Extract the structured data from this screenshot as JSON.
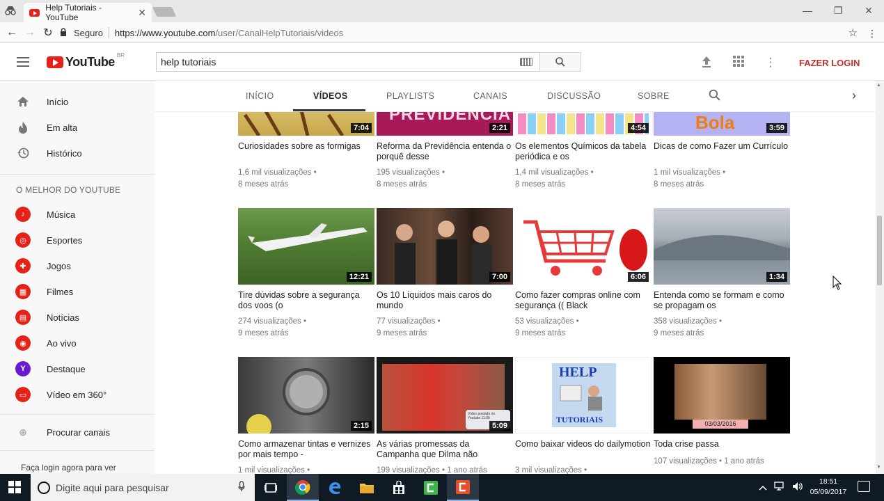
{
  "browser": {
    "tab_title": "Help Tutoriais - YouTube",
    "secure_label": "Seguro",
    "url_host": "https://www.youtube.com",
    "url_path": "/user/CanalHelpTutoriais/videos"
  },
  "header": {
    "logo_text": "YouTube",
    "logo_region": "BR",
    "search_value": "help tutoriais",
    "login_label": "FAZER LOGIN"
  },
  "sidebar": {
    "main": [
      {
        "label": "Início",
        "icon": "home-icon"
      },
      {
        "label": "Em alta",
        "icon": "flame-icon"
      },
      {
        "label": "Histórico",
        "icon": "history-icon"
      }
    ],
    "best_heading": "O MELHOR DO YOUTUBE",
    "best": [
      {
        "label": "Música",
        "icon": "music-icon"
      },
      {
        "label": "Esportes",
        "icon": "sports-icon"
      },
      {
        "label": "Jogos",
        "icon": "gamepad-icon"
      },
      {
        "label": "Filmes",
        "icon": "film-icon"
      },
      {
        "label": "Notícias",
        "icon": "news-icon"
      },
      {
        "label": "Ao vivo",
        "icon": "live-icon"
      },
      {
        "label": "Destaque",
        "icon": "spotlight-icon"
      },
      {
        "label": "Vídeo em 360°",
        "icon": "video360-icon"
      }
    ],
    "browse_channels": "Procurar canais",
    "login_prompt": "Faça login agora para ver"
  },
  "channel_tabs": {
    "items": [
      "INÍCIO",
      "VÍDEOS",
      "PLAYLISTS",
      "CANAIS",
      "DISCUSSÃO",
      "SOBRE"
    ],
    "active": "VÍDEOS"
  },
  "videos": [
    {
      "title": "Curiosidades sobre as formigas",
      "views": "1,6 mil visualizações",
      "age": "8 meses atrás",
      "duration": "7:04"
    },
    {
      "title": "Reforma da Previdência entenda o porquê desse",
      "views": "195 visualizações",
      "age": "8 meses atrás",
      "duration": "2:21",
      "thumb_text": "PREVIDÊNCIA"
    },
    {
      "title": "Os elementos Químicos da tabela periódica e os",
      "views": "1,4 mil visualizações",
      "age": "8 meses atrás",
      "duration": "4:54"
    },
    {
      "title": "Dicas de como Fazer um Currículo",
      "views": "1 mil visualizações",
      "age": "8 meses atrás",
      "duration": "3:59",
      "thumb_text": "Bola"
    },
    {
      "title": "Tire dúvidas sobre a segurança dos voos (o",
      "views": "274 visualizações",
      "age": "9 meses atrás",
      "duration": "12:21"
    },
    {
      "title": "Os 10 Líquidos mais caros do mundo",
      "views": "77 visualizações",
      "age": "9 meses atrás",
      "duration": "7:00"
    },
    {
      "title": "Como fazer compras online com segurança (( Black",
      "views": "53 visualizações",
      "age": "9 meses atrás",
      "duration": "6:06"
    },
    {
      "title": "Entenda como se formam e como se propagam os",
      "views": "358 visualizações",
      "age": "9 meses atrás",
      "duration": "1:34"
    },
    {
      "title": "Como armazenar tintas e vernizes por mais tempo -",
      "views": "1 mil visualizações",
      "age": "",
      "duration": "2:15"
    },
    {
      "title": "As várias promessas da Campanha que Dilma não",
      "views": "199 visualizações",
      "age": "1 ano atrás",
      "duration": "5:09",
      "thumb_text": "Vídeo postado no Youtube 11:09"
    },
    {
      "title": "Como baixar videos do dailymotion",
      "views": "3 mil visualizações",
      "age": "",
      "duration": "",
      "thumb_text_top": "HELP",
      "thumb_text_bottom": "TUTORIAIS"
    },
    {
      "title": "Toda crise passa",
      "views": "107 visualizações",
      "age": "1 ano atrás",
      "duration": "",
      "thumb_text": "03/03/2016"
    }
  ],
  "taskbar": {
    "search_placeholder": "Digite aqui para pesquisar",
    "time": "18:51",
    "date": "05/09/2017"
  }
}
